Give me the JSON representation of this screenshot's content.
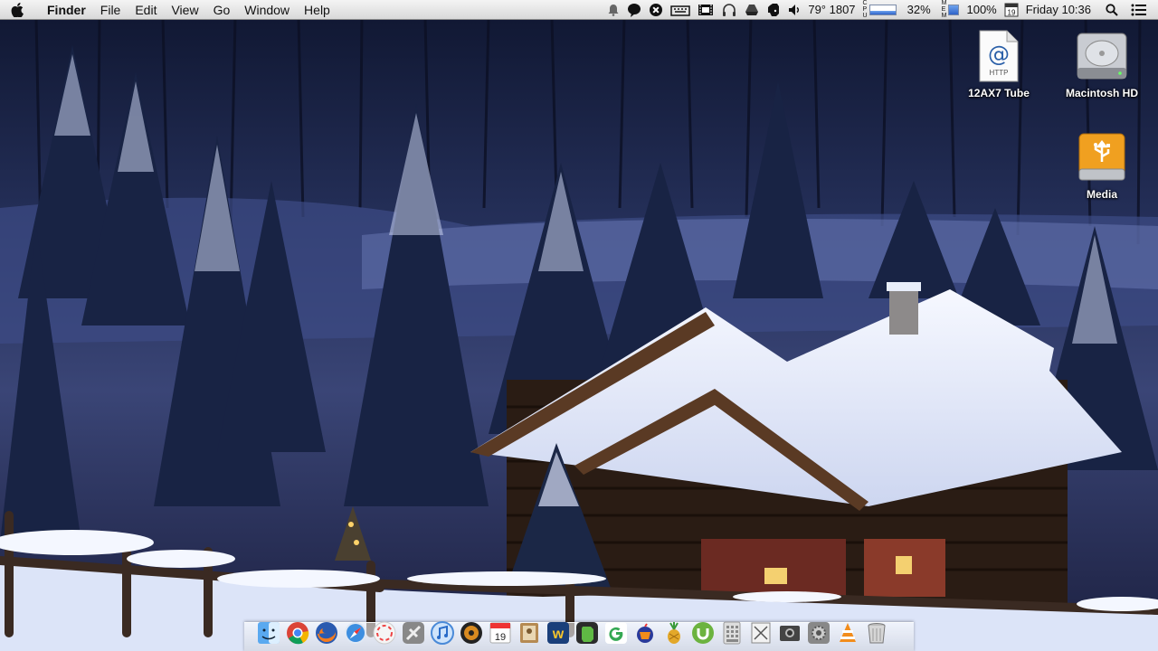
{
  "menubar": {
    "app_name": "Finder",
    "menus": [
      "File",
      "Edit",
      "View",
      "Go",
      "Window",
      "Help"
    ],
    "status": {
      "weather": "79° 1807",
      "cpu_label": "C P U",
      "cpu_percent": "32%",
      "mem_label": "M E M",
      "mem_percent": "100%",
      "calendar_day": "19",
      "clock": "Friday 10:36"
    },
    "status_icons": [
      "bell-icon",
      "speech-bubble-icon",
      "crossed-circle-icon",
      "keyboard-icon",
      "film-icon",
      "headphones-icon",
      "drive-icon",
      "evernote-icon",
      "speaker-icon",
      "spotlight-icon",
      "list-icon"
    ]
  },
  "desktop_icons": [
    {
      "label": "12AX7 Tube",
      "icon": "http-document-icon"
    },
    {
      "label": "Macintosh HD",
      "icon": "hard-drive-icon"
    },
    {
      "label": "Media",
      "icon": "usb-drive-icon"
    }
  ],
  "dock": {
    "apps": [
      "finder-icon",
      "chrome-icon",
      "firefox-icon",
      "safari-icon",
      "lifesaver-icon",
      "satellite-icon",
      "itunes-icon",
      "speaker-icon",
      "calendar-icon",
      "contacts-icon",
      "wunderlist-icon",
      "evernote-icon",
      "google-icon",
      "folder-bomb-icon",
      "pineapple-icon",
      "utorrent-icon",
      "calculator-icon",
      "script-icon",
      "photo-icon",
      "system-preferences-icon",
      "vlc-icon",
      "trash-icon"
    ],
    "calendar_day": "19"
  },
  "colors": {
    "menubar_top": "#f4f4f4",
    "menubar_bottom": "#d9d9d9",
    "sky_night": "#1a2240",
    "snow": "#e8eefa"
  }
}
